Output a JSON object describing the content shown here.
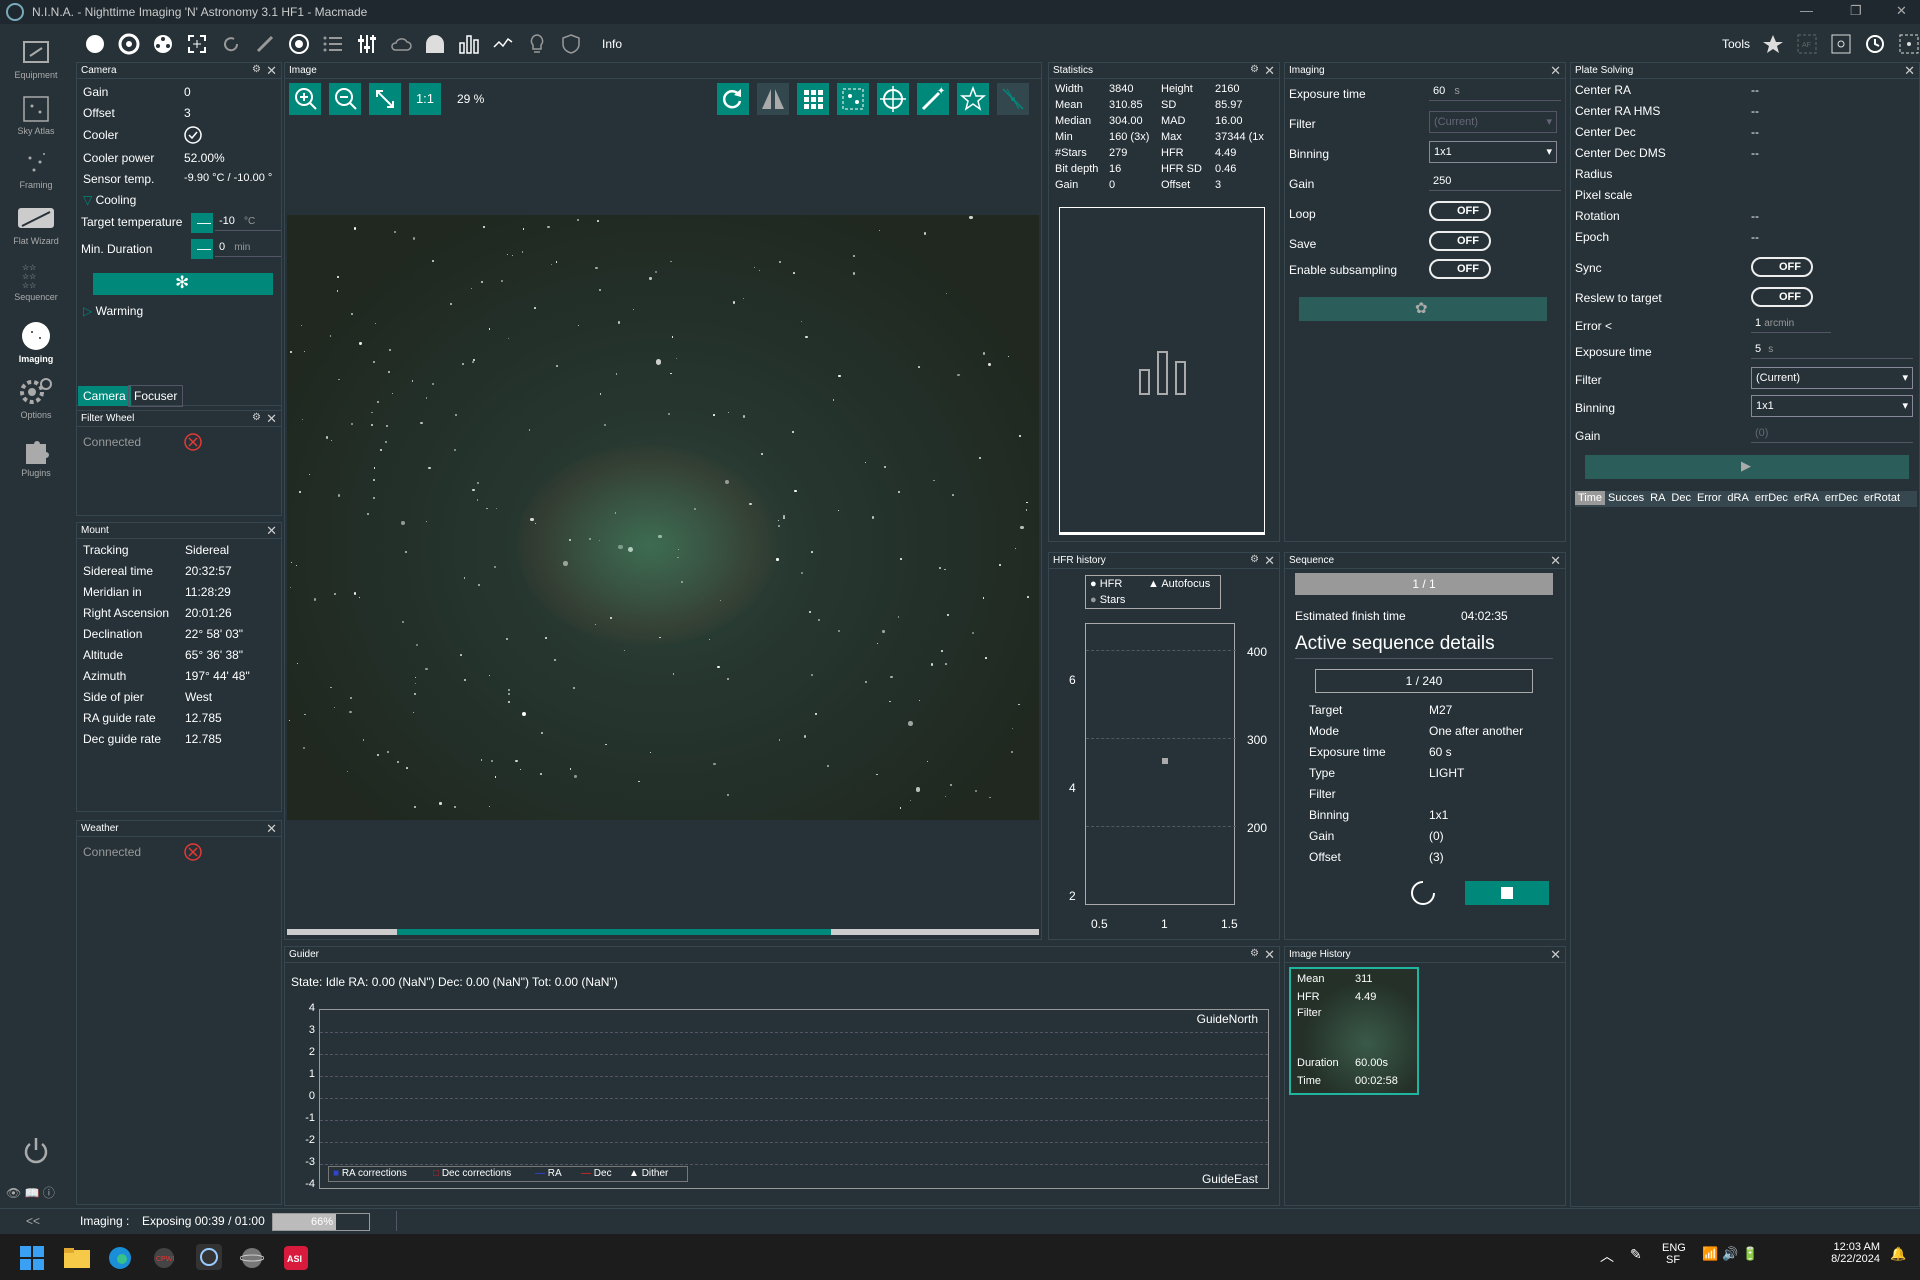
{
  "window": {
    "title": "N.I.N.A. - Nighttime Imaging 'N' Astronomy 3.1 HF1  -  Macmade"
  },
  "sidebar": {
    "items": [
      {
        "label": "Equipment"
      },
      {
        "label": "Sky Atlas"
      },
      {
        "label": "Framing"
      },
      {
        "label": "Flat Wizard"
      },
      {
        "label": "Sequencer"
      },
      {
        "label": "Imaging"
      },
      {
        "label": "Options"
      },
      {
        "label": "Plugins"
      }
    ],
    "collapse_label": "<<"
  },
  "toolbar": {
    "info_label": "Info",
    "tools_label": "Tools"
  },
  "camera": {
    "title": "Camera",
    "rows": [
      {
        "label": "Gain",
        "value": "0"
      },
      {
        "label": "Offset",
        "value": "3"
      },
      {
        "label": "Cooler",
        "value": ""
      },
      {
        "label": "Cooler power",
        "value": "52.00%"
      },
      {
        "label": "Sensor temp.",
        "value": "-9.90 °C / -10.00 °"
      }
    ],
    "cooling_label": "Cooling",
    "target_temp_label": "Target temperature",
    "target_temp_value": "-10",
    "target_temp_unit": "°C",
    "min_duration_label": "Min. Duration",
    "min_duration_value": "0",
    "min_duration_unit": "min",
    "warming_label": "Warming",
    "tabs": [
      "Camera",
      "Focuser"
    ]
  },
  "filterwheel": {
    "title": "Filter Wheel",
    "connected_label": "Connected"
  },
  "mount": {
    "title": "Mount",
    "rows": [
      {
        "label": "Tracking",
        "value": "Sidereal"
      },
      {
        "label": "Sidereal time",
        "value": "20:32:57"
      },
      {
        "label": "Meridian in",
        "value": "11:28:29"
      },
      {
        "label": "Right Ascension",
        "value": "20:01:26"
      },
      {
        "label": "Declination",
        "value": "22° 58' 03\""
      },
      {
        "label": "Altitude",
        "value": "65° 36' 38\""
      },
      {
        "label": "Azimuth",
        "value": "197° 44' 48\""
      },
      {
        "label": "Side of pier",
        "value": "West"
      },
      {
        "label": "RA guide rate",
        "value": "12.785"
      },
      {
        "label": "Dec guide rate",
        "value": "12.785"
      }
    ]
  },
  "weather": {
    "title": "Weather",
    "connected_label": "Connected"
  },
  "image": {
    "title": "Image",
    "one_to_one": "1:1",
    "zoom": "29 %",
    "scroll_fraction": 0.7
  },
  "statistics": {
    "title": "Statistics",
    "left": [
      {
        "label": "Width",
        "value": "3840"
      },
      {
        "label": "Mean",
        "value": "310.85"
      },
      {
        "label": "Median",
        "value": "304.00"
      },
      {
        "label": "Min",
        "value": "160 (3x)"
      },
      {
        "label": "#Stars",
        "value": "279"
      },
      {
        "label": "Bit depth",
        "value": "16"
      },
      {
        "label": "Gain",
        "value": "0"
      }
    ],
    "right": [
      {
        "label": "Height",
        "value": "2160"
      },
      {
        "label": "SD",
        "value": "85.97"
      },
      {
        "label": "MAD",
        "value": "16.00"
      },
      {
        "label": "Max",
        "value": "37344 (1x"
      },
      {
        "label": "HFR",
        "value": "4.49"
      },
      {
        "label": "HFR SD",
        "value": "0.46"
      },
      {
        "label": "Offset",
        "value": "3"
      }
    ]
  },
  "hfr": {
    "title": "HFR history",
    "legend": [
      "HFR",
      "Autofocus",
      "Stars"
    ],
    "y_left_ticks": [
      "6",
      "4",
      "2"
    ],
    "y_right_ticks": [
      "400",
      "300",
      "200"
    ],
    "x_ticks": [
      "0.5",
      "1",
      "1.5"
    ]
  },
  "imaging": {
    "title": "Imaging",
    "exposure_label": "Exposure time",
    "exposure_value": "60",
    "exposure_unit": "s",
    "filter_label": "Filter",
    "filter_value": "(Current)",
    "binning_label": "Binning",
    "binning_value": "1x1",
    "gain_label": "Gain",
    "gain_value": "250",
    "loop_label": "Loop",
    "save_label": "Save",
    "subsampling_label": "Enable subsampling",
    "off": "OFF"
  },
  "sequence": {
    "title": "Sequence",
    "progress": "1 / 1",
    "finish_label": "Estimated finish time",
    "finish_value": "04:02:35",
    "details_title": "Active sequence details",
    "count": "1 / 240",
    "rows": [
      {
        "label": "Target",
        "value": "M27"
      },
      {
        "label": "Mode",
        "value": "One after another"
      },
      {
        "label": "Exposure time",
        "value": "60 s"
      },
      {
        "label": "Type",
        "value": "LIGHT"
      },
      {
        "label": "Filter",
        "value": ""
      },
      {
        "label": "Binning",
        "value": "1x1"
      },
      {
        "label": "Gain",
        "value": "(0)"
      },
      {
        "label": "Offset",
        "value": "(3)"
      }
    ]
  },
  "platesolve": {
    "title": "Plate Solving",
    "rows": [
      {
        "label": "Center RA",
        "value": "--"
      },
      {
        "label": "Center RA HMS",
        "value": "--"
      },
      {
        "label": "Center Dec",
        "value": "--"
      },
      {
        "label": "Center Dec DMS",
        "value": "--"
      },
      {
        "label": "Radius",
        "value": ""
      },
      {
        "label": "Pixel scale",
        "value": ""
      },
      {
        "label": "Rotation",
        "value": "--"
      },
      {
        "label": "Epoch",
        "value": "--"
      }
    ],
    "sync_label": "Sync",
    "reslew_label": "Reslew to target",
    "error_label": "Error <",
    "error_value": "1",
    "error_unit": "arcmin",
    "exp_label": "Exposure time",
    "exp_value": "5",
    "exp_unit": "s",
    "filter_label": "Filter",
    "filter_value": "(Current)",
    "binning_label": "Binning",
    "binning_value": "1x1",
    "gain_label": "Gain",
    "gain_value": "(0)",
    "off": "OFF",
    "columns": [
      "Time",
      "Succes",
      "RA",
      "Dec",
      "Error",
      "dRA",
      "errDec",
      "erRA",
      "errDec",
      "erRotat"
    ]
  },
  "guider": {
    "title": "Guider",
    "state": "State: Idle  RA: 0.00 (NaN\")  Dec: 0.00 (NaN\")  Tot: 0.00 (NaN\")",
    "y_ticks": [
      "4",
      "3",
      "2",
      "1",
      "0",
      "-1",
      "-2",
      "-3",
      "-4"
    ],
    "north": "GuideNorth",
    "east": "GuideEast",
    "legend": [
      "RA corrections",
      "Dec corrections",
      "RA",
      "Dec",
      "Dither"
    ]
  },
  "history": {
    "title": "Image History",
    "mean_label": "Mean",
    "mean_value": "311",
    "hfr_label": "HFR",
    "hfr_value": "4.49",
    "filter_label": "Filter",
    "duration_label": "Duration",
    "duration_value": "60.00s",
    "time_label": "Time",
    "time_value": "00:02:58"
  },
  "status": {
    "label": "Imaging :",
    "text": "Exposing 00:39 / 01:00",
    "progress_text": "66%",
    "progress_fraction": 0.66
  },
  "taskbar": {
    "lang1": "ENG",
    "lang2": "SF",
    "time": "12:03 AM",
    "date": "8/22/2024"
  },
  "colors": {
    "accent": "#00897b",
    "bg": "#263238",
    "error": "#e53935"
  }
}
